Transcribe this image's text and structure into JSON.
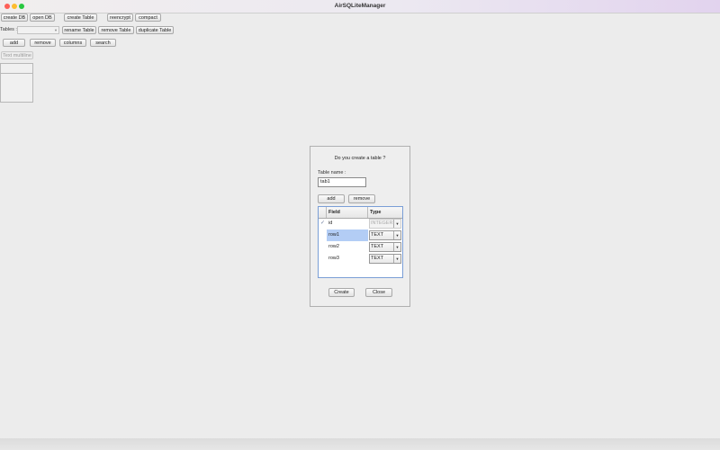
{
  "window": {
    "title": "AirSQLiteManager"
  },
  "toolbar": {
    "row1": [
      "create DB",
      "open DB",
      "create Table",
      "reencrypt",
      "compact"
    ],
    "tables_label": "Tables :",
    "row2": [
      "rename Table",
      "remove Table",
      "duplicate Table"
    ],
    "row3": [
      "add",
      "remove",
      "columns",
      "search"
    ],
    "text_multiline": "Text multiline"
  },
  "dialog": {
    "message": "Do you create a table ?",
    "table_name_label": "Table name :",
    "table_name_value": "tab1",
    "add_label": "add",
    "remove_label": "remove",
    "columns": {
      "field": "Field",
      "type": "Type"
    },
    "rows": [
      {
        "checked": true,
        "field": "id",
        "type": "INTEGER",
        "disabled": true
      },
      {
        "checked": false,
        "field": "row1",
        "type": "TEXT",
        "selected": true
      },
      {
        "checked": false,
        "field": "row2",
        "type": "TEXT"
      },
      {
        "checked": false,
        "field": "row3",
        "type": "TEXT"
      }
    ],
    "create_label": "Create",
    "close_label": "Close"
  }
}
